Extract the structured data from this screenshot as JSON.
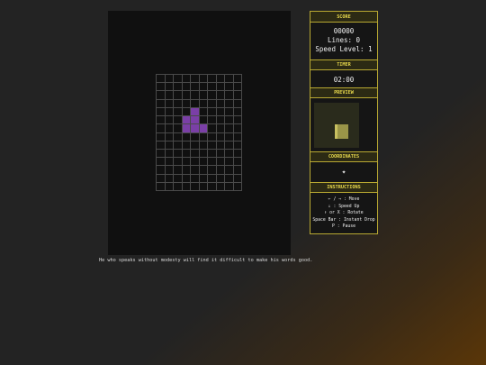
{
  "game": {
    "board_cols": 10,
    "board_rows": 14,
    "piece_color": "#7a3fa6",
    "active_piece_cells": [
      [
        4,
        4
      ],
      [
        3,
        5
      ],
      [
        4,
        5
      ],
      [
        3,
        6
      ],
      [
        4,
        6
      ],
      [
        5,
        6
      ]
    ]
  },
  "quote": "He who speaks without modesty will find it difficult to make his words good.",
  "panel": {
    "score_title": "SCORE",
    "score_value": "00000",
    "lines_text": "Lines: 0",
    "speed_text": "Speed Level: 1",
    "timer_title": "TIMER",
    "timer_value": "02:00",
    "preview_title": "PREVIEW",
    "coordinates_title": "COORDINATES",
    "coordinates_icon": "✦",
    "instructions_title": "INSTRUCTIONS",
    "instructions": [
      "← / → : Move",
      "↓ : Speed Up",
      "↑ or X : Rotate",
      "Space Bar : Instant Drop",
      "P : Pause"
    ]
  },
  "colors": {
    "accent": "#e7d84c",
    "panel_border": "#b8a832",
    "preview_piece": "#9a9548"
  }
}
